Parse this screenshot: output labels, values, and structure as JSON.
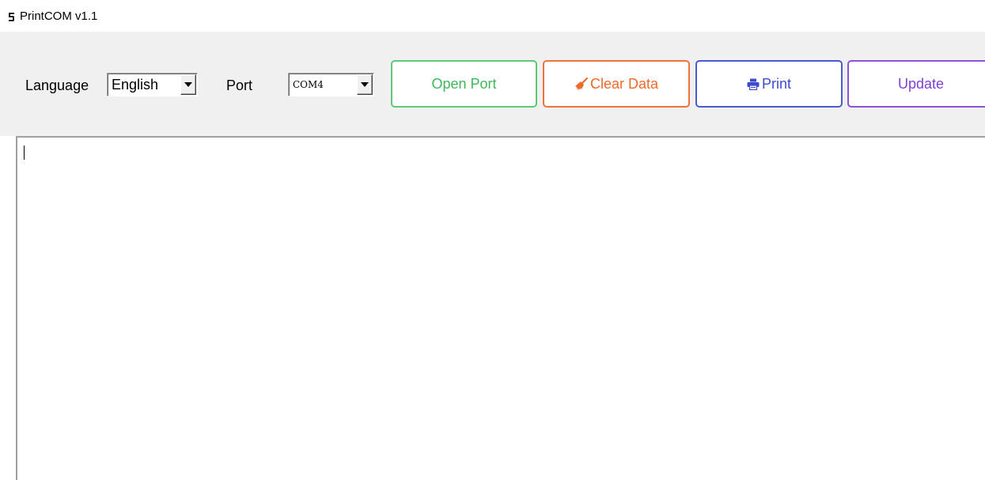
{
  "window": {
    "title": "PrintCOM v1.1",
    "icon": "app-logo-icon"
  },
  "toolbar": {
    "language_label": "Language",
    "language_value": "English",
    "port_label": "Port",
    "port_value": "COM4",
    "open_port_label": "Open Port",
    "clear_data_label": "Clear Data",
    "clear_data_icon": "broom-icon",
    "print_label": "Print",
    "print_icon": "printer-icon",
    "update_label": "Update"
  },
  "output": {
    "text": ""
  },
  "colors": {
    "toolbar_background": "#f0f0f0",
    "open_port": "#3fb65a",
    "clear_data": "#ee6a2a",
    "print": "#3c4ccc",
    "update": "#7d40d6"
  }
}
